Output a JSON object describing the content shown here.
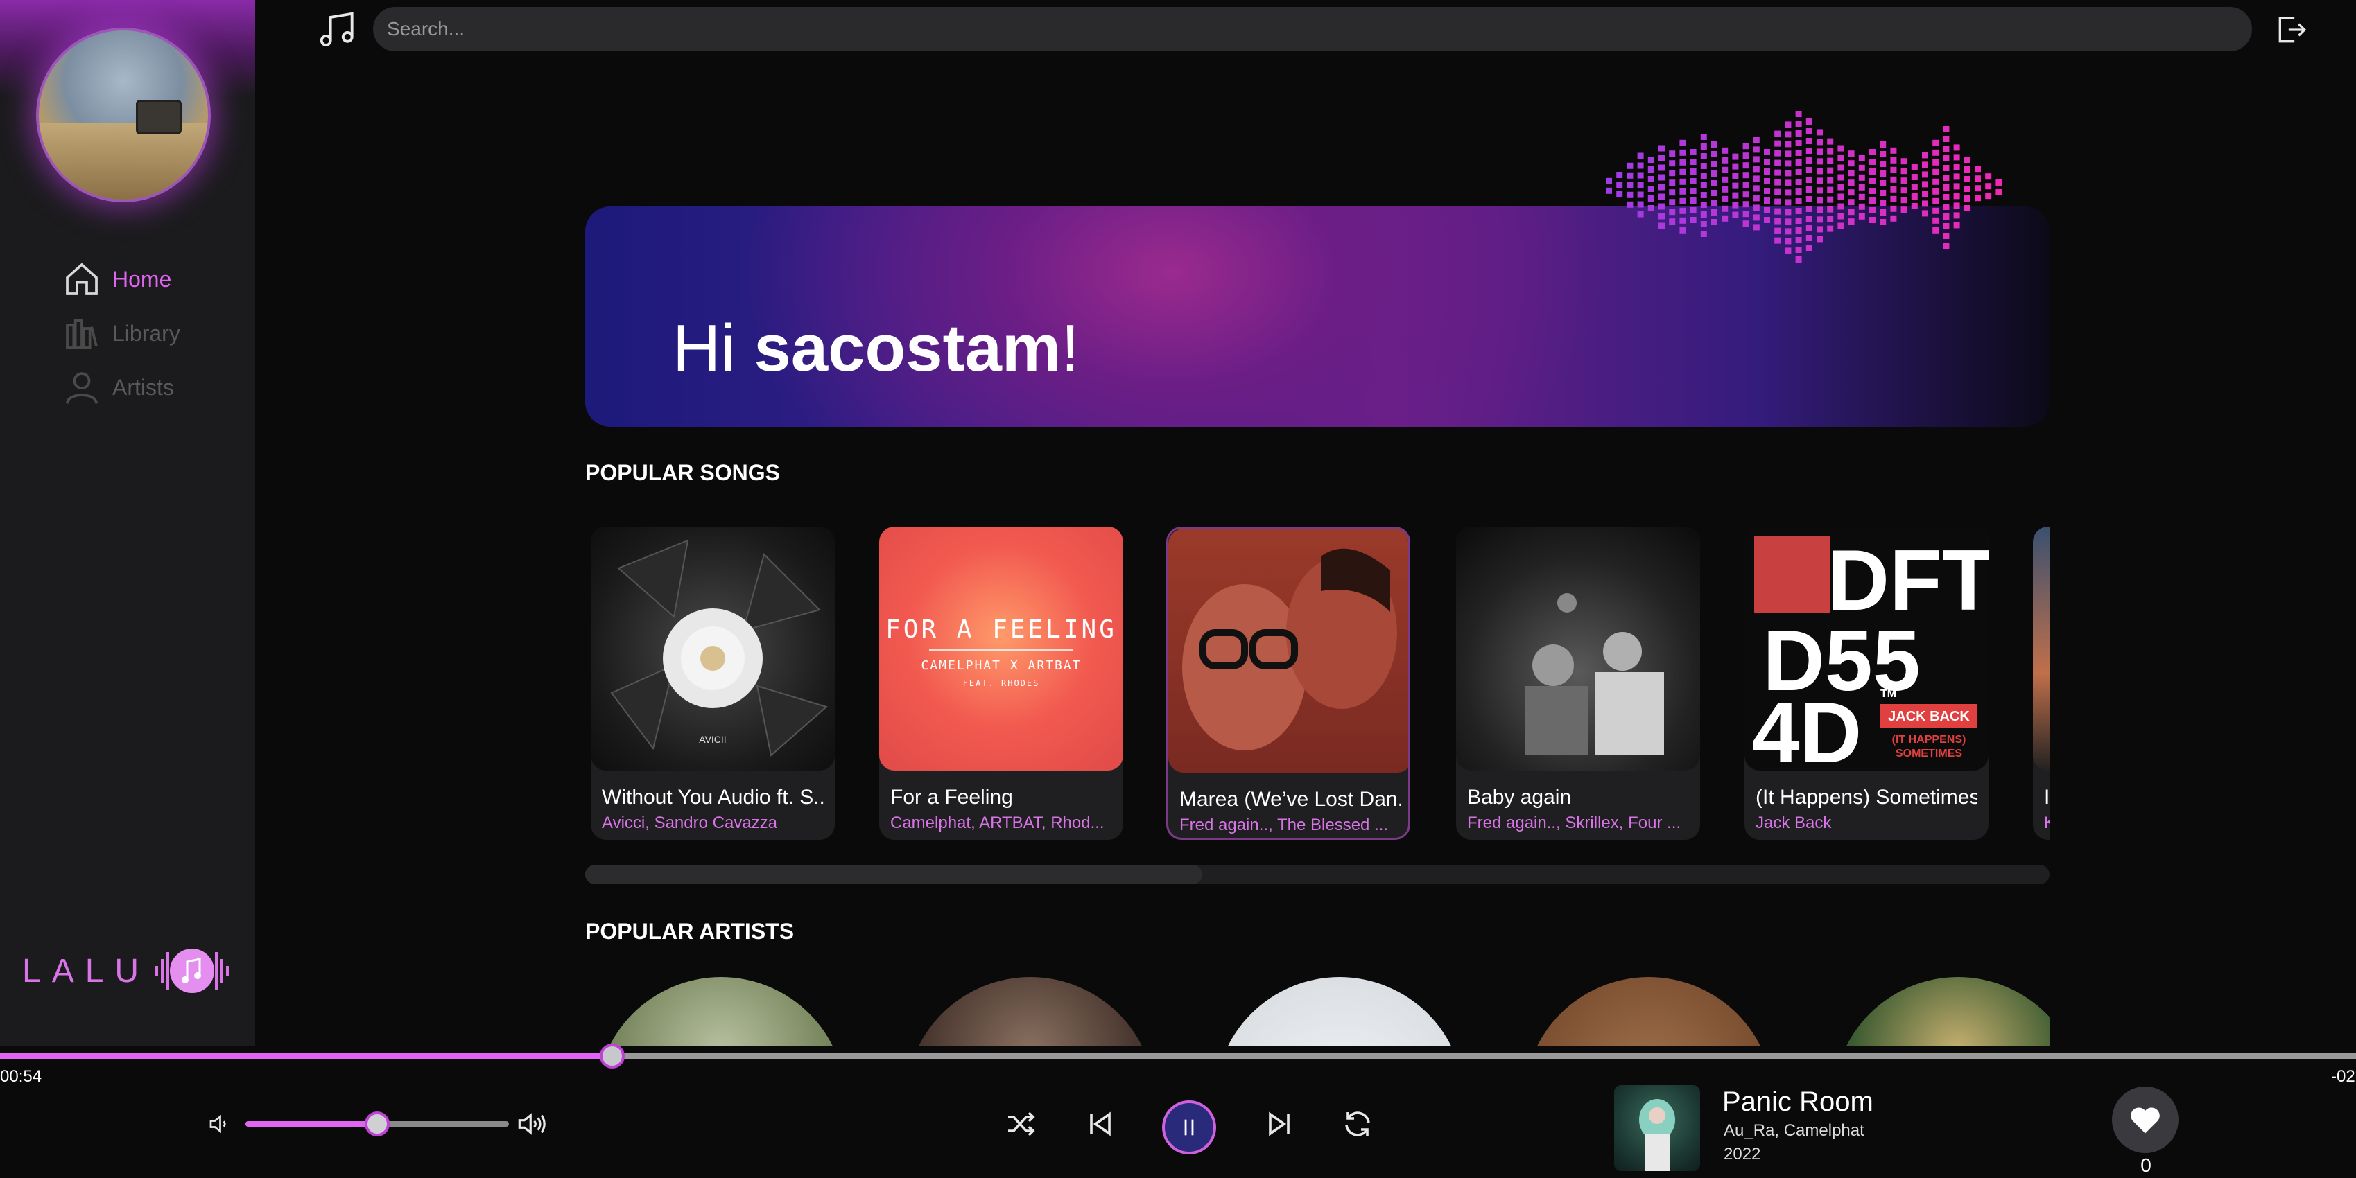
{
  "app": {
    "brand": "LALU"
  },
  "colors": {
    "accent": "#e065f0",
    "background": "#0a0a0b",
    "sidebar": "#1b1b1d"
  },
  "sidebar": {
    "items": [
      {
        "label": "Home",
        "icon": "home-icon",
        "active": true
      },
      {
        "label": "Library",
        "icon": "library-icon",
        "active": false
      },
      {
        "label": "Artists",
        "icon": "person-icon",
        "active": false
      }
    ]
  },
  "search": {
    "placeholder": "Search..."
  },
  "hero": {
    "greeting": "Hi ",
    "username": "sacostam",
    "exclaim": "!"
  },
  "sections": {
    "popular_songs": "POPULAR SONGS",
    "popular_artists": "POPULAR ARTISTS"
  },
  "songs": [
    {
      "title": "Without You Audio ft. S...",
      "artists": "Avicci, Sandro Cavazza"
    },
    {
      "title": "For a Feeling",
      "artists": "Camelphat, ARTBAT, Rhod..."
    },
    {
      "title": "Marea (We’ve Lost Dan...",
      "artists": "Fred again.., The Blessed ..."
    },
    {
      "title": "Baby again",
      "artists": "Fred again.., Skrillex, Four ..."
    },
    {
      "title": "(It Happens) Sometimes",
      "artists": "Jack Back"
    },
    {
      "title": "I",
      "artists": "K"
    }
  ],
  "covers": {
    "avicii": "AVICII",
    "feeling_title": "FOR A FEELING",
    "feeling_sub": "CAMELPHAT X ARTBAT",
    "feeling_feat": "FEAT. RHODES",
    "dft_line1": "DFT",
    "dft_line2": "D55",
    "dft_line3": "4D",
    "dft_tm": "TM",
    "dft_label": "JACK BACK",
    "dft_sub1": "(IT HAPPENS)",
    "dft_sub2": "SOMETIMES"
  },
  "player": {
    "elapsed": "00:54",
    "remaining": "-02",
    "progress_fraction": 0.26,
    "volume_fraction": 0.5,
    "now_playing": {
      "title": "Panic Room",
      "artists": "Au_Ra, Camelphat",
      "year": "2022"
    },
    "likes": "0"
  }
}
